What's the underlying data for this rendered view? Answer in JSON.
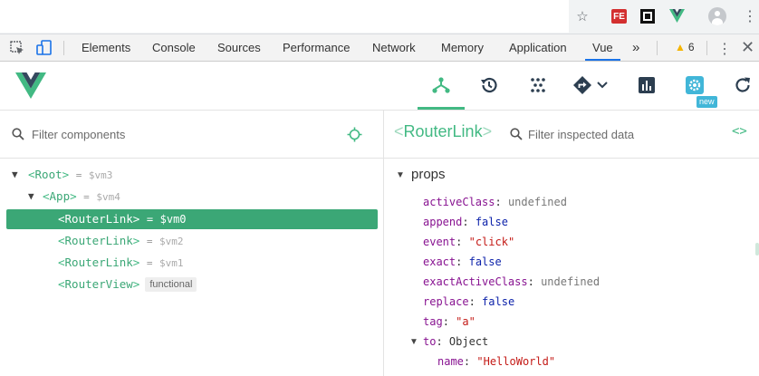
{
  "chrome": {
    "ext_fe_label": "FE",
    "icons": [
      "star-icon",
      "fe-extension-icon",
      "square-extension-icon",
      "vue-extension-icon",
      "profile-avatar",
      "kebab-menu-icon"
    ]
  },
  "devtools": {
    "tabs": [
      "Elements",
      "Console",
      "Sources",
      "Performance",
      "Network",
      "Memory",
      "Application",
      "Vue"
    ],
    "active_tab": "Vue",
    "more_tabs": "»",
    "warning_count": "6"
  },
  "vue_toolbar": {
    "new_badge": "new",
    "accent": "#42b983"
  },
  "components": {
    "filter_placeholder": "Filter components",
    "tree": [
      {
        "name": "Root",
        "ref": "$vm3",
        "expanded": true
      },
      {
        "name": "App",
        "ref": "$vm4",
        "expanded": true
      },
      {
        "name": "RouterLink",
        "ref": "$vm0",
        "selected": true
      },
      {
        "name": "RouterLink",
        "ref": "$vm2"
      },
      {
        "name": "RouterLink",
        "ref": "$vm1"
      },
      {
        "name": "RouterView",
        "badge": "functional"
      }
    ]
  },
  "inspector": {
    "component_name": "RouterLink",
    "filter_placeholder": "Filter inspected data",
    "section": "props",
    "props": [
      {
        "key": "activeClass",
        "value": "undefined",
        "kind": "undef"
      },
      {
        "key": "append",
        "value": "false",
        "kind": "bool"
      },
      {
        "key": "event",
        "value": "\"click\"",
        "kind": "str"
      },
      {
        "key": "exact",
        "value": "false",
        "kind": "bool"
      },
      {
        "key": "exactActiveClass",
        "value": "undefined",
        "kind": "undef"
      },
      {
        "key": "replace",
        "value": "false",
        "kind": "bool"
      },
      {
        "key": "tag",
        "value": "\"a\"",
        "kind": "str"
      },
      {
        "key": "to",
        "value": "Object",
        "kind": "obj"
      }
    ],
    "nested": [
      {
        "key": "name",
        "value": "\"HelloWorld\"",
        "kind": "str"
      }
    ]
  },
  "glyphs": {
    "lt": "<",
    "gt": ">",
    "eq": "=",
    "colon": ":",
    "code": "<>"
  }
}
